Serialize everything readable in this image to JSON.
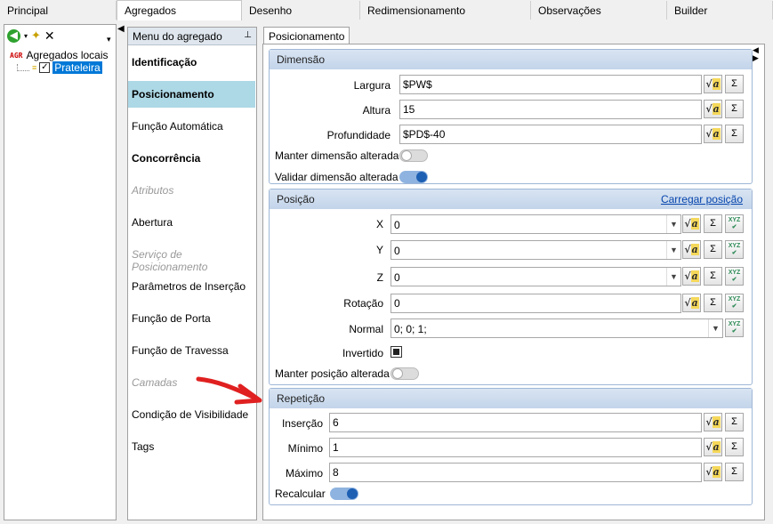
{
  "top_tabs": [
    "Principal",
    "Agregados",
    "Desenho",
    "Redimensionamento",
    "Observações",
    "Builder"
  ],
  "tree": {
    "root": "Agregados locais",
    "root_tag": "AGR",
    "child": "Prateleira"
  },
  "menu": {
    "title": "Menu do agregado",
    "items": [
      "Identificação",
      "Posicionamento",
      "Função Automática",
      "Concorrência",
      "Atributos",
      "Abertura",
      "Serviço de Posicionamento",
      "Parâmetros de Inserção",
      "Função de Porta",
      "Função de Travessa",
      "Camadas",
      "Condição de Visibilidade",
      "Tags"
    ]
  },
  "panel_tab": "Posicionamento",
  "dimensao": {
    "title": "Dimensão",
    "largura_label": "Largura",
    "largura_value": "$PW$",
    "altura_label": "Altura",
    "altura_value": "15",
    "profundidade_label": "Profundidade",
    "profundidade_value": "$PD$-40",
    "manter_label": "Manter dimensão alterada",
    "manter_on": false,
    "validar_label": "Validar dimensão alterada",
    "validar_on": true
  },
  "posicao": {
    "title": "Posição",
    "link": "Carregar posição",
    "x_label": "X",
    "x_value": "0",
    "y_label": "Y",
    "y_value": "0",
    "z_label": "Z",
    "z_value": "0",
    "rotacao_label": "Rotação",
    "rotacao_value": "0",
    "normal_label": "Normal",
    "normal_value": "0; 0; 1;",
    "invertido_label": "Invertido",
    "manter_label": "Manter posição alterada",
    "manter_on": false
  },
  "repeticao": {
    "title": "Repetição",
    "insercao_label": "Inserção",
    "insercao_value": "6",
    "minimo_label": "Mínimo",
    "minimo_value": "1",
    "maximo_label": "Máximo",
    "maximo_value": "8",
    "recalcular_label": "Recalcular",
    "recalcular_on": true
  },
  "icons": {
    "sqrt": "square-root-icon",
    "sigma": "Σ",
    "xyz": "xyz-icon"
  },
  "colors": {
    "accent": "#1d5fb3",
    "selected_menu": "#add8e6",
    "arrow": "#e02020"
  }
}
